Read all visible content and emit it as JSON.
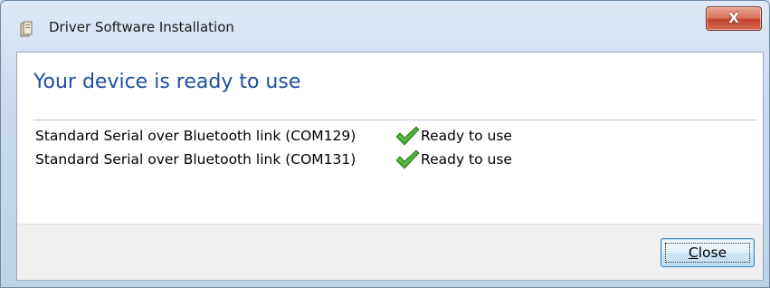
{
  "window": {
    "title": "Driver Software Installation",
    "close_glyph": "X",
    "icon": "driver-installer-icon"
  },
  "main": {
    "heading": "Your device is ready to use",
    "devices": [
      {
        "name": "Standard Serial over Bluetooth link (COM129)",
        "status": "Ready to use",
        "status_icon": "green-checkmark-icon"
      },
      {
        "name": "Standard Serial over Bluetooth link (COM131)",
        "status": "Ready to use",
        "status_icon": "green-checkmark-icon"
      }
    ]
  },
  "footer": {
    "close_button_label": "Close",
    "close_button_access_key": "C"
  },
  "colors": {
    "heading": "#1c50a0",
    "check": "#3fa22b",
    "titlebar_close": "#c4432c"
  }
}
